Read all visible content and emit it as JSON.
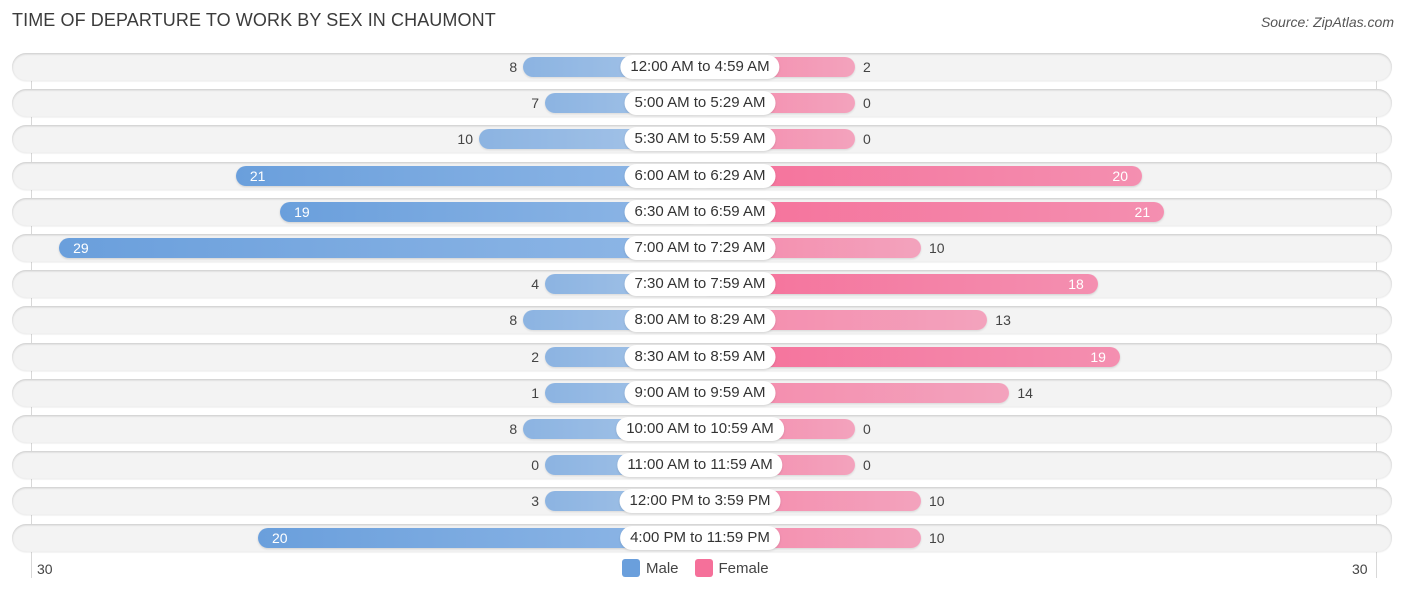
{
  "header": {
    "title": "TIME OF DEPARTURE TO WORK BY SEX IN CHAUMONT",
    "source": "Source: ZipAtlas.com"
  },
  "colors": {
    "male": "#6a9fdc",
    "female": "#f5709a"
  },
  "chart_data": {
    "type": "bar",
    "orientation": "horizontal-diverging",
    "title": "TIME OF DEPARTURE TO WORK BY SEX IN CHAUMONT",
    "categories": [
      "12:00 AM to 4:59 AM",
      "5:00 AM to 5:29 AM",
      "5:30 AM to 5:59 AM",
      "6:00 AM to 6:29 AM",
      "6:30 AM to 6:59 AM",
      "7:00 AM to 7:29 AM",
      "7:30 AM to 7:59 AM",
      "8:00 AM to 8:29 AM",
      "8:30 AM to 8:59 AM",
      "9:00 AM to 9:59 AM",
      "10:00 AM to 10:59 AM",
      "11:00 AM to 11:59 AM",
      "12:00 PM to 3:59 PM",
      "4:00 PM to 11:59 PM"
    ],
    "series": [
      {
        "name": "Male",
        "values": [
          8,
          7,
          10,
          21,
          19,
          29,
          4,
          8,
          2,
          1,
          8,
          0,
          3,
          20
        ]
      },
      {
        "name": "Female",
        "values": [
          2,
          0,
          0,
          20,
          21,
          10,
          18,
          13,
          19,
          14,
          0,
          0,
          10,
          10
        ]
      }
    ],
    "axis": {
      "left_tick": "30",
      "right_tick": "30",
      "range": [
        0,
        30
      ]
    },
    "legend": {
      "position": "bottom-center",
      "entries": [
        "Male",
        "Female"
      ]
    },
    "grid": false
  }
}
